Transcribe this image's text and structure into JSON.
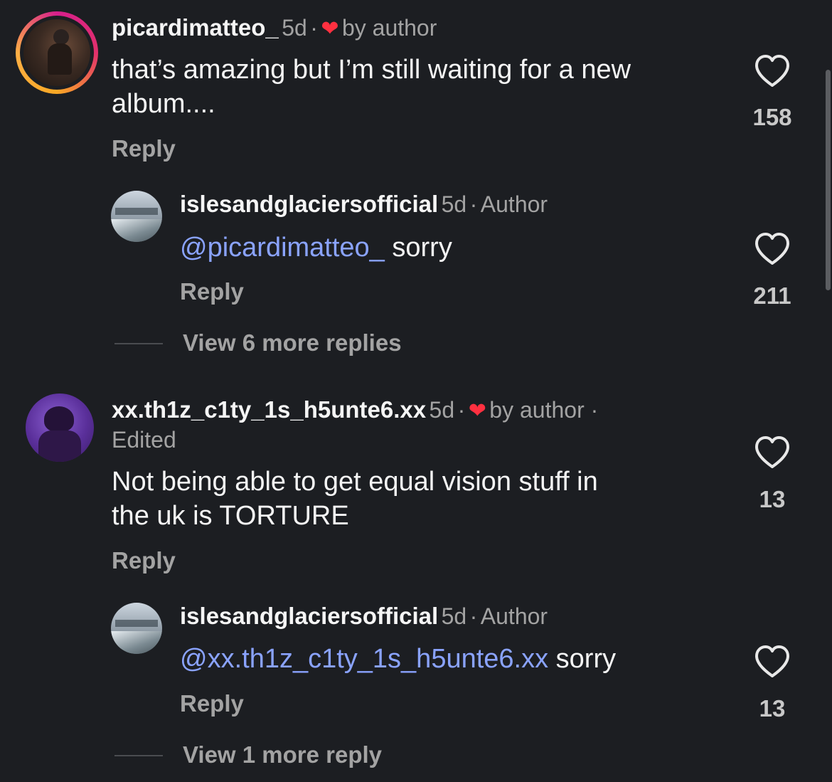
{
  "comments": [
    {
      "username": "picardimatteo_",
      "time": "5d",
      "dot": "·",
      "badge": "by author",
      "text_line1": "that’s amazing but I’m still waiting for a new",
      "text_line2": "album....",
      "reply": "Reply",
      "likes": "158",
      "replies": [
        {
          "username": "islesandglaciersofficial",
          "time": "5d",
          "dot": "·",
          "badge": "Author",
          "mention": "@picardimatteo_",
          "text": " sorry",
          "reply": "Reply",
          "likes": "211"
        }
      ],
      "view_more": "View 6 more replies"
    },
    {
      "username": "xx.th1z_c1ty_1s_h5unte6.xx",
      "time": "5d",
      "dot": "·",
      "badge": "by author ·",
      "edited": "Edited",
      "text_line1": "Not being able to get equal vision stuff in",
      "text_line2": "the uk is TORTURE",
      "reply": "Reply",
      "likes": "13",
      "replies": [
        {
          "username": "islesandglaciersofficial",
          "time": "5d",
          "dot": "·",
          "badge": "Author",
          "mention": "@xx.th1z_c1ty_1s_h5unte6.xx",
          "text": " sorry",
          "reply": "Reply",
          "likes": "13"
        }
      ],
      "view_more": "View 1 more reply"
    }
  ],
  "icons": {
    "like": "heart-outline-icon",
    "liked_by_author": "heart-filled-icon"
  },
  "colors": {
    "background": "#1c1e22",
    "mention": "#8aa3ff",
    "heart_red": "#ff3040",
    "story_ring_start": "#f9a825",
    "story_ring_end": "#d61f8c"
  }
}
